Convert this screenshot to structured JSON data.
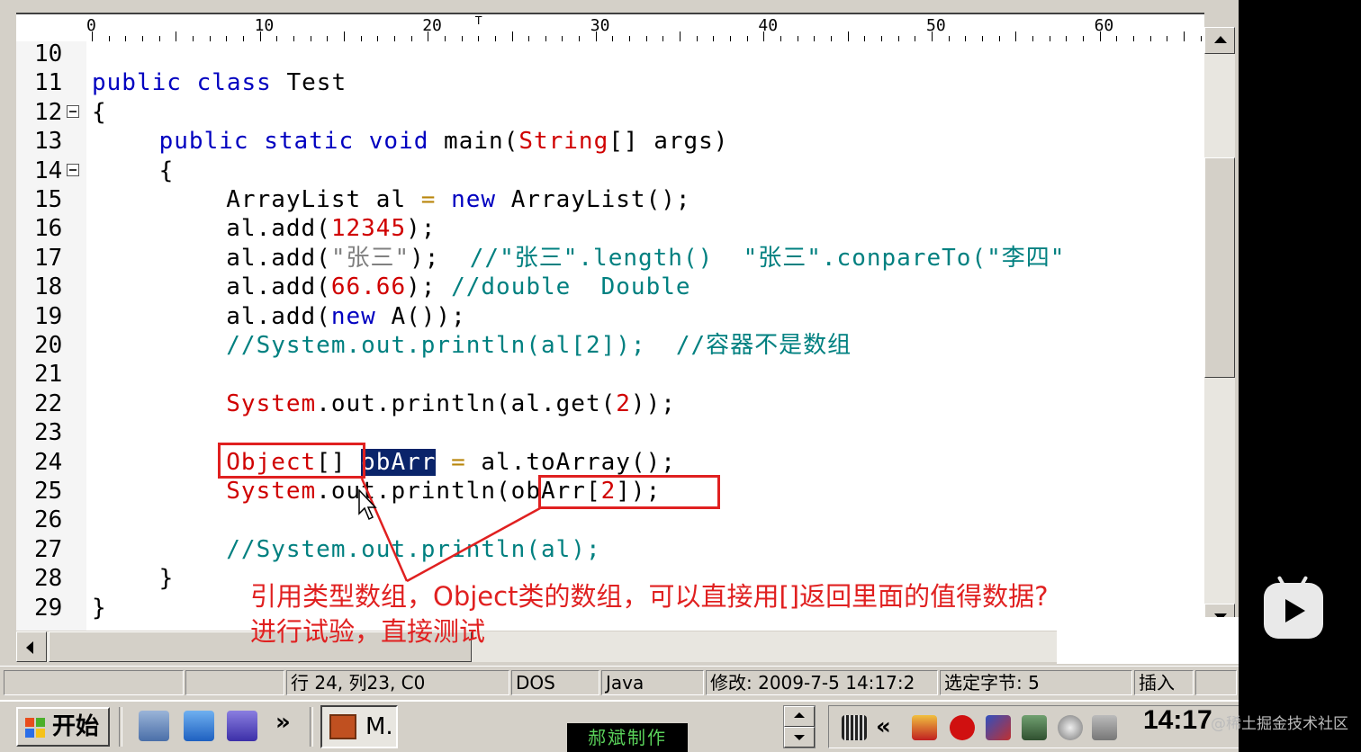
{
  "ruler": {
    "labels": [
      "0",
      "10",
      "20",
      "30",
      "40",
      "50",
      "60"
    ],
    "caret": "T"
  },
  "code_lines": [
    {
      "num": "10",
      "fold": false,
      "indent": 0,
      "tokens": []
    },
    {
      "num": "11",
      "fold": false,
      "indent": 0,
      "tokens": [
        {
          "cls": "k",
          "text": "public class"
        },
        {
          "cls": "p",
          "text": " Test"
        }
      ]
    },
    {
      "num": "12",
      "fold": true,
      "indent": 0,
      "tokens": [
        {
          "cls": "p",
          "text": "{"
        }
      ]
    },
    {
      "num": "13",
      "fold": false,
      "indent": 4,
      "tokens": [
        {
          "cls": "k",
          "text": "public static void"
        },
        {
          "cls": "p",
          "text": " main("
        },
        {
          "cls": "t",
          "text": "String"
        },
        {
          "cls": "p",
          "text": "[] args)"
        }
      ]
    },
    {
      "num": "14",
      "fold": true,
      "indent": 4,
      "tokens": [
        {
          "cls": "p",
          "text": "{"
        }
      ]
    },
    {
      "num": "15",
      "fold": false,
      "indent": 8,
      "tokens": [
        {
          "cls": "p",
          "text": "ArrayList al "
        },
        {
          "cls": "o",
          "text": "="
        },
        {
          "cls": "p",
          "text": " "
        },
        {
          "cls": "k",
          "text": "new"
        },
        {
          "cls": "p",
          "text": " ArrayList();"
        }
      ]
    },
    {
      "num": "16",
      "fold": false,
      "indent": 8,
      "tokens": [
        {
          "cls": "p",
          "text": "al.add("
        },
        {
          "cls": "n",
          "text": "12345"
        },
        {
          "cls": "p",
          "text": ");"
        }
      ]
    },
    {
      "num": "17",
      "fold": false,
      "indent": 8,
      "tokens": [
        {
          "cls": "p",
          "text": "al.add("
        },
        {
          "cls": "s",
          "text": "\"张三\""
        },
        {
          "cls": "p",
          "text": "); "
        },
        {
          "cls": "c",
          "text": " //\"张三\".length()  \"张三\".conpareTo(\"李四\""
        }
      ]
    },
    {
      "num": "18",
      "fold": false,
      "indent": 8,
      "tokens": [
        {
          "cls": "p",
          "text": "al.add("
        },
        {
          "cls": "n",
          "text": "66.66"
        },
        {
          "cls": "p",
          "text": "); "
        },
        {
          "cls": "c",
          "text": "//double  Double"
        }
      ]
    },
    {
      "num": "19",
      "fold": false,
      "indent": 8,
      "tokens": [
        {
          "cls": "p",
          "text": "al.add("
        },
        {
          "cls": "k",
          "text": "new"
        },
        {
          "cls": "p",
          "text": " A());"
        }
      ]
    },
    {
      "num": "20",
      "fold": false,
      "indent": 8,
      "tokens": [
        {
          "cls": "c",
          "text": "//System.out.println(al[2]);  //容器不是数组"
        }
      ]
    },
    {
      "num": "21",
      "fold": false,
      "indent": 0,
      "tokens": []
    },
    {
      "num": "22",
      "fold": false,
      "indent": 8,
      "tokens": [
        {
          "cls": "t",
          "text": "System"
        },
        {
          "cls": "p",
          "text": ".out.println(al.get("
        },
        {
          "cls": "n",
          "text": "2"
        },
        {
          "cls": "p",
          "text": "));"
        }
      ]
    },
    {
      "num": "23",
      "fold": false,
      "indent": 0,
      "tokens": []
    },
    {
      "num": "24",
      "fold": false,
      "indent": 8,
      "tokens": [
        {
          "cls": "t",
          "text": "Object"
        },
        {
          "cls": "p",
          "text": "[] "
        },
        {
          "cls": "sel",
          "text": "obArr"
        },
        {
          "cls": "p",
          "text": " "
        },
        {
          "cls": "o",
          "text": "="
        },
        {
          "cls": "p",
          "text": " al.toArray();"
        }
      ]
    },
    {
      "num": "25",
      "fold": false,
      "indent": 8,
      "tokens": [
        {
          "cls": "t",
          "text": "System"
        },
        {
          "cls": "p",
          "text": ".out.println(obArr["
        },
        {
          "cls": "n",
          "text": "2"
        },
        {
          "cls": "p",
          "text": "]);"
        }
      ]
    },
    {
      "num": "26",
      "fold": false,
      "indent": 0,
      "tokens": []
    },
    {
      "num": "27",
      "fold": false,
      "indent": 8,
      "tokens": [
        {
          "cls": "c",
          "text": "//System.out.println(al);"
        }
      ]
    },
    {
      "num": "28",
      "fold": false,
      "indent": 4,
      "tokens": [
        {
          "cls": "p",
          "text": "}"
        }
      ]
    },
    {
      "num": "29",
      "fold": false,
      "indent": 0,
      "tokens": [
        {
          "cls": "p",
          "text": "}"
        }
      ]
    }
  ],
  "annotation": {
    "line1": "引用类型数组，Object类的数组，可以直接用[]返回里面的值得数据?",
    "line2": "进行试验，直接测试"
  },
  "statusbar": {
    "position": "行 24, 列23, C0",
    "line_ending": "DOS",
    "language": "Java",
    "modified": "修改:  2009-7-5 14:17:2",
    "selected": "选定字节: 5",
    "mode": "插入"
  },
  "taskbar": {
    "start_label": "开始",
    "quicklaunch_more": "»",
    "task_button_label": "M.",
    "credit": "郝斌制作",
    "tray_chevron": "«",
    "clock": "14:17"
  },
  "watermark": "@稀土掘金技术社区",
  "colors": {
    "keyword": "#0000c0",
    "type": "#d00000",
    "comment": "#008080",
    "number": "#d00000",
    "string": "#808080",
    "selection": "#0a246a",
    "annotation": "#e02020"
  }
}
